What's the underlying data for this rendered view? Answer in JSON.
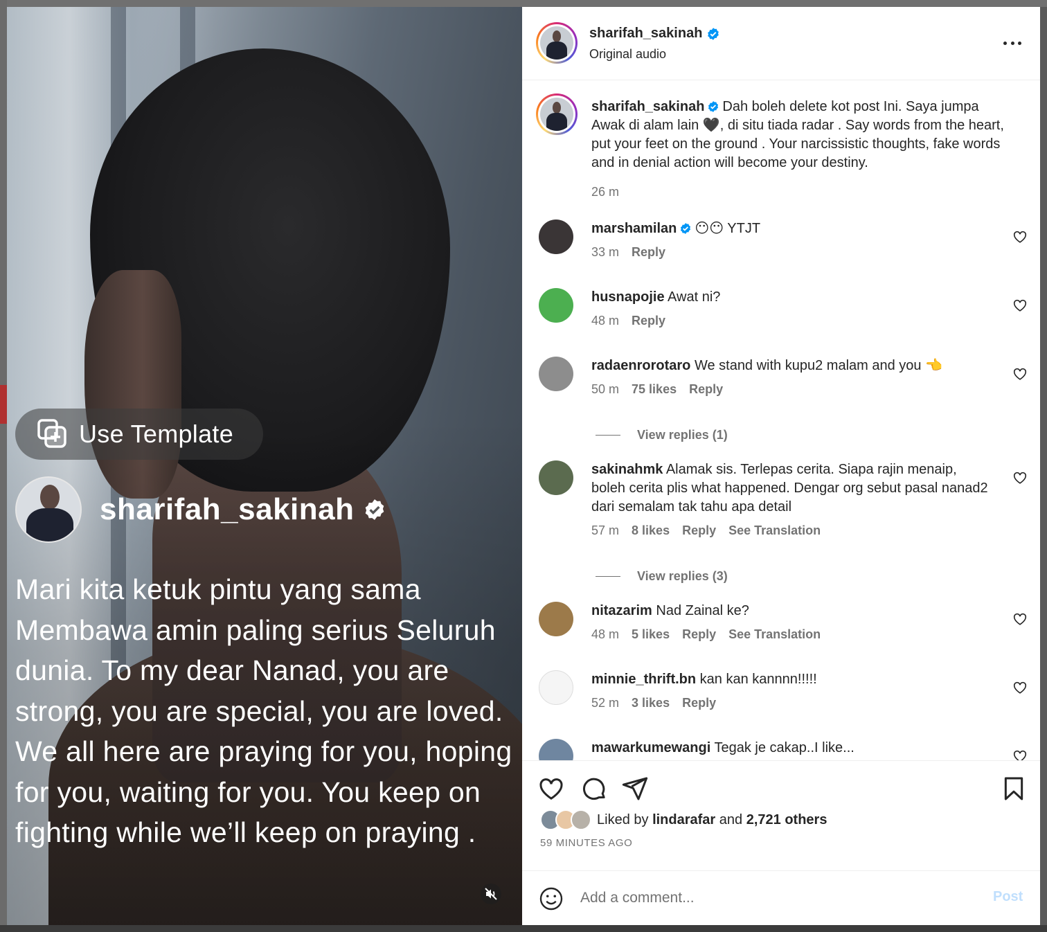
{
  "media": {
    "template_label": "Use Template",
    "overlay_username": "sharifah_sakinah",
    "overlay_text": "Mari kita ketuk pintu yang sama Membawa amin paling serius Seluruh dunia. To my dear Nanad, you are strong, you are special, you are loved. We  all here are praying for you, hoping for you, waiting for you. You keep on fighting while we’ll keep on praying ."
  },
  "header": {
    "username": "sharifah_sakinah",
    "subtitle": "Original audio"
  },
  "caption": {
    "username": "sharifah_sakinah",
    "text": "Dah boleh delete kot post Ini. Saya jumpa Awak di alam lain 🖤, di situ tiada radar . Say words from the heart, put your feet on the ground . Your narcissistic thoughts, fake words and in denial action will become your destiny.",
    "time": "26 m"
  },
  "comments": [
    {
      "username": "marshamilan",
      "text": "😶😶 YTJT",
      "time": "33 m",
      "likes": "",
      "reply": "Reply",
      "translation": "",
      "verified": true,
      "avatar_color": "#3a3536"
    },
    {
      "username": "husnapojie",
      "text": "Awat ni?",
      "time": "48 m",
      "likes": "",
      "reply": "Reply",
      "translation": "",
      "verified": false,
      "avatar_color": "#4caf50"
    },
    {
      "username": "radaenrorotaro",
      "text": "We stand with kupu2 malam and you 👈",
      "time": "50 m",
      "likes": "75 likes",
      "reply": "Reply",
      "translation": "",
      "verified": false,
      "avatar_color": "#8d8d8d"
    },
    {
      "username": "sakinahmk",
      "text": "Alamak sis. Terlepas cerita. Siapa rajin menaip, boleh cerita plis what happened. Dengar org sebut pasal nanad2 dari semalam tak tahu apa detail",
      "time": "57 m",
      "likes": "8 likes",
      "reply": "Reply",
      "translation": "See Translation",
      "verified": false,
      "avatar_color": "#5b6b4f"
    },
    {
      "username": "nitazarim",
      "text": "Nad Zainal ke?",
      "time": "48 m",
      "likes": "5 likes",
      "reply": "Reply",
      "translation": "See Translation",
      "verified": false,
      "avatar_color": "#9c7a4a"
    },
    {
      "username": "minnie_thrift.bn",
      "text": "kan kan kannnn!!!!!",
      "time": "52 m",
      "likes": "3 likes",
      "reply": "Reply",
      "translation": "",
      "verified": false,
      "avatar_color": "#f5f5f5"
    },
    {
      "username": "mawarkumewangi",
      "text": "Tegak je cakap..I like...",
      "time": "",
      "likes": "",
      "reply": "",
      "translation": "",
      "verified": false,
      "avatar_color": "#6f86a0"
    }
  ],
  "replies": [
    {
      "label": "View replies (1)"
    },
    {
      "label": "View replies (3)"
    }
  ],
  "likes": {
    "prefix": "Liked by",
    "user": "lindarafar",
    "joiner": "and",
    "others": "2,721 others",
    "time_ago": "59 MINUTES AGO"
  },
  "add_comment": {
    "placeholder": "Add a comment...",
    "post_label": "Post"
  },
  "colors": {
    "verified": "#0095f6",
    "post_disabled": "#c0dffd",
    "secondary_text": "#737373"
  }
}
